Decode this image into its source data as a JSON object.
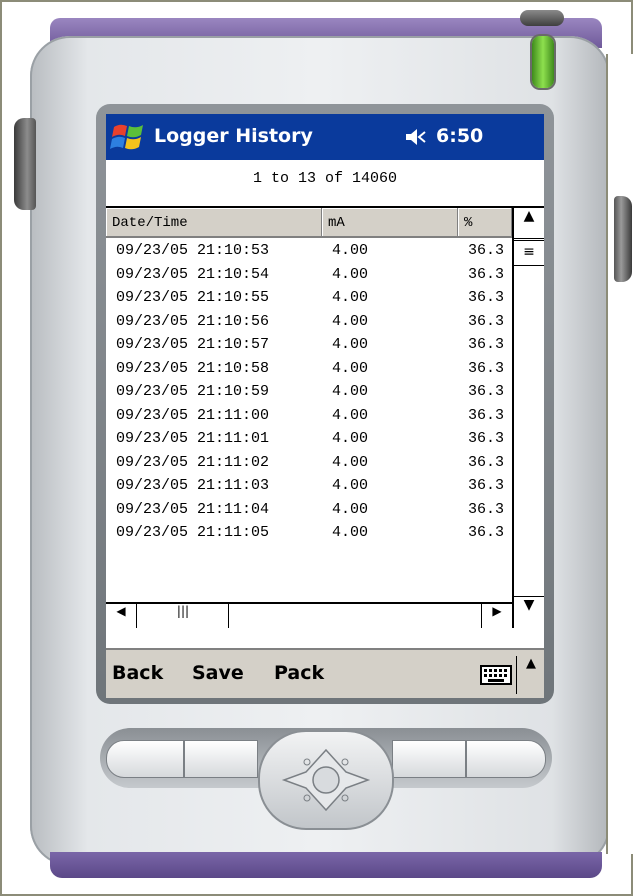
{
  "app": {
    "title": "Logger History",
    "time": "6:50"
  },
  "range_text": "1 to 13 of 14060",
  "table": {
    "columns": [
      "Date/Time",
      "mA",
      "%"
    ],
    "rows": [
      [
        "09/23/05 21:10:53",
        "4.00",
        "36.3"
      ],
      [
        "09/23/05 21:10:54",
        "4.00",
        "36.3"
      ],
      [
        "09/23/05 21:10:55",
        "4.00",
        "36.3"
      ],
      [
        "09/23/05 21:10:56",
        "4.00",
        "36.3"
      ],
      [
        "09/23/05 21:10:57",
        "4.00",
        "36.3"
      ],
      [
        "09/23/05 21:10:58",
        "4.00",
        "36.3"
      ],
      [
        "09/23/05 21:10:59",
        "4.00",
        "36.3"
      ],
      [
        "09/23/05 21:11:00",
        "4.00",
        "36.3"
      ],
      [
        "09/23/05 21:11:01",
        "4.00",
        "36.3"
      ],
      [
        "09/23/05 21:11:02",
        "4.00",
        "36.3"
      ],
      [
        "09/23/05 21:11:03",
        "4.00",
        "36.3"
      ],
      [
        "09/23/05 21:11:04",
        "4.00",
        "36.3"
      ],
      [
        "09/23/05 21:11:05",
        "4.00",
        "36.3"
      ]
    ]
  },
  "menu": {
    "back": "Back",
    "save": "Save",
    "pack": "Pack"
  },
  "icons": {
    "start": "windows-flag-icon",
    "speaker": "speaker-muted-icon",
    "keyboard": "keyboard-icon"
  },
  "colors": {
    "titlebar": "#0a3a9c",
    "device_trim": "#6f5a9a",
    "led": "#8ee04e"
  }
}
